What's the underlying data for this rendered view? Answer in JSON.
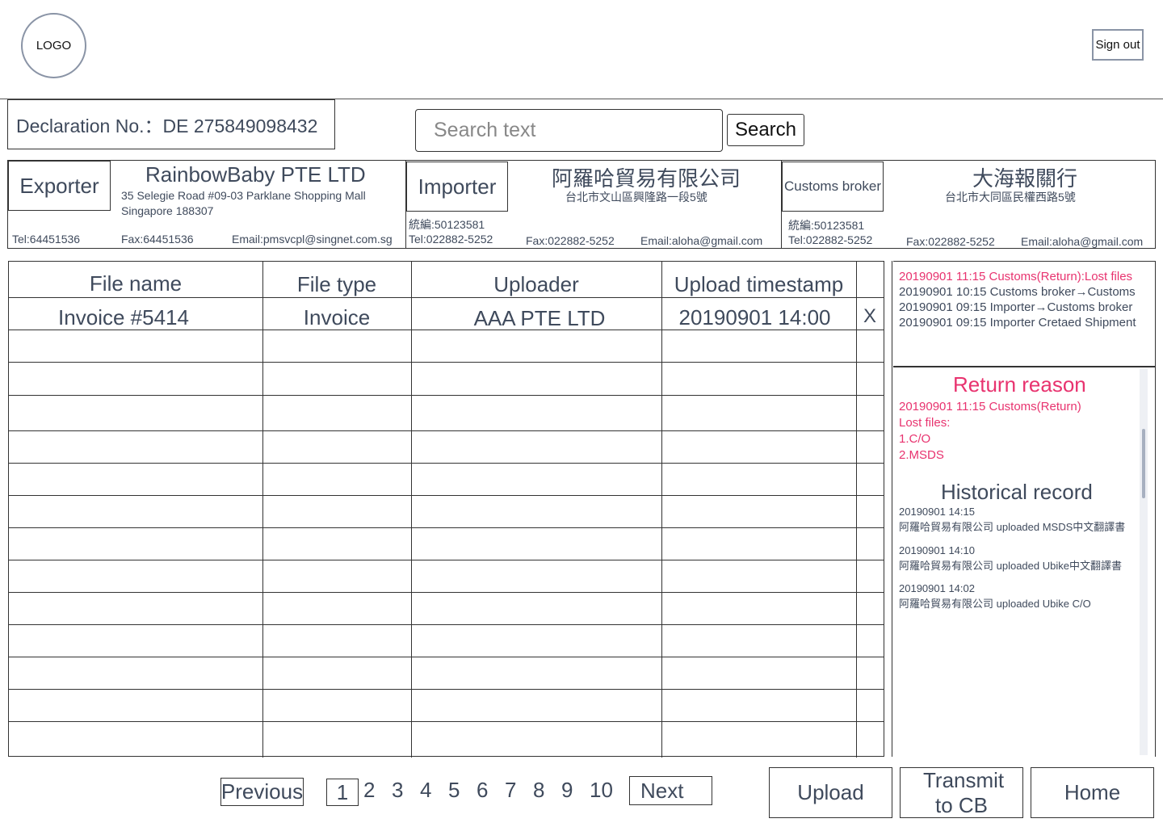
{
  "header": {
    "logo": "LOGO",
    "sign_out": "Sign out"
  },
  "declaration": {
    "label": "Declaration No.：DE 275849098432"
  },
  "search": {
    "placeholder": "Search text",
    "button": "Search"
  },
  "parties": {
    "exporter": {
      "role": "Exporter",
      "name": "RainbowBaby PTE LTD",
      "address_line1": "35 Selegie Road  #09-03 Parklane Shopping Mall",
      "address_line2": "Singapore 188307",
      "tel": "Tel:64451536",
      "fax": "Fax:64451536",
      "email": "Email:pmsvcpl@singnet.com.sg"
    },
    "importer": {
      "role": "Importer",
      "name": "阿羅哈貿易有限公司",
      "address": "台北市文山區興隆路一段5號",
      "tax_id": "統編:50123581",
      "tel": "Tel:022882-5252",
      "fax": "Fax:022882-5252",
      "email": "Email:aloha@gmail.com"
    },
    "broker": {
      "role": "Customs broker",
      "name": "大海報關行",
      "address": "台北市大同區民權西路5號",
      "tax_id": "統編:50123581",
      "tel": "Tel:022882-5252",
      "fax": "Fax:022882-5252",
      "email": "Email:aloha@gmail.com"
    }
  },
  "file_table": {
    "columns": [
      "File name",
      "File type",
      "Uploader",
      "Upload timestamp"
    ],
    "rows": [
      {
        "file_name": "Invoice #5414",
        "file_type": "Invoice",
        "uploader": "AAA PTE LTD",
        "timestamp": "20190901 14:00",
        "delete": "X"
      }
    ]
  },
  "status_log": [
    {
      "text": "20190901 11:15 Customs(Return):Lost files",
      "highlight": true
    },
    {
      "text": "20190901 10:15 Customs broker→Customs",
      "highlight": false
    },
    {
      "text": "20190901 09:15 Importer→Customs broker",
      "highlight": false
    },
    {
      "text": "20190901 09:15 Importer Cretaed Shipment",
      "highlight": false
    }
  ],
  "return_reason": {
    "title": "Return reason",
    "lines": [
      "20190901 11:15 Customs(Return)",
      "Lost files:",
      "1.C/O",
      "2.MSDS"
    ]
  },
  "history": {
    "title": "Historical record",
    "entries": [
      {
        "time": "20190901 14:15",
        "text": "阿羅哈貿易有限公司  uploaded MSDS中文翻譯書"
      },
      {
        "time": "20190901 14:10",
        "text": "阿羅哈貿易有限公司  uploaded Ubike中文翻譯書"
      },
      {
        "time": "20190901 14:02",
        "text": " 阿羅哈貿易有限公司 uploaded Ubike C/O"
      }
    ]
  },
  "pagination": {
    "previous": "Previous",
    "next": "Next",
    "pages": [
      "1",
      "2",
      "3",
      "4",
      "5",
      "6",
      "7",
      "8",
      "9",
      "10"
    ],
    "current": "1"
  },
  "actions": {
    "upload": "Upload",
    "transmit": "Transmit to CB",
    "home": "Home"
  },
  "colors": {
    "highlight": "#e8336f",
    "text": "#3f4a5c",
    "border": "#333333"
  }
}
